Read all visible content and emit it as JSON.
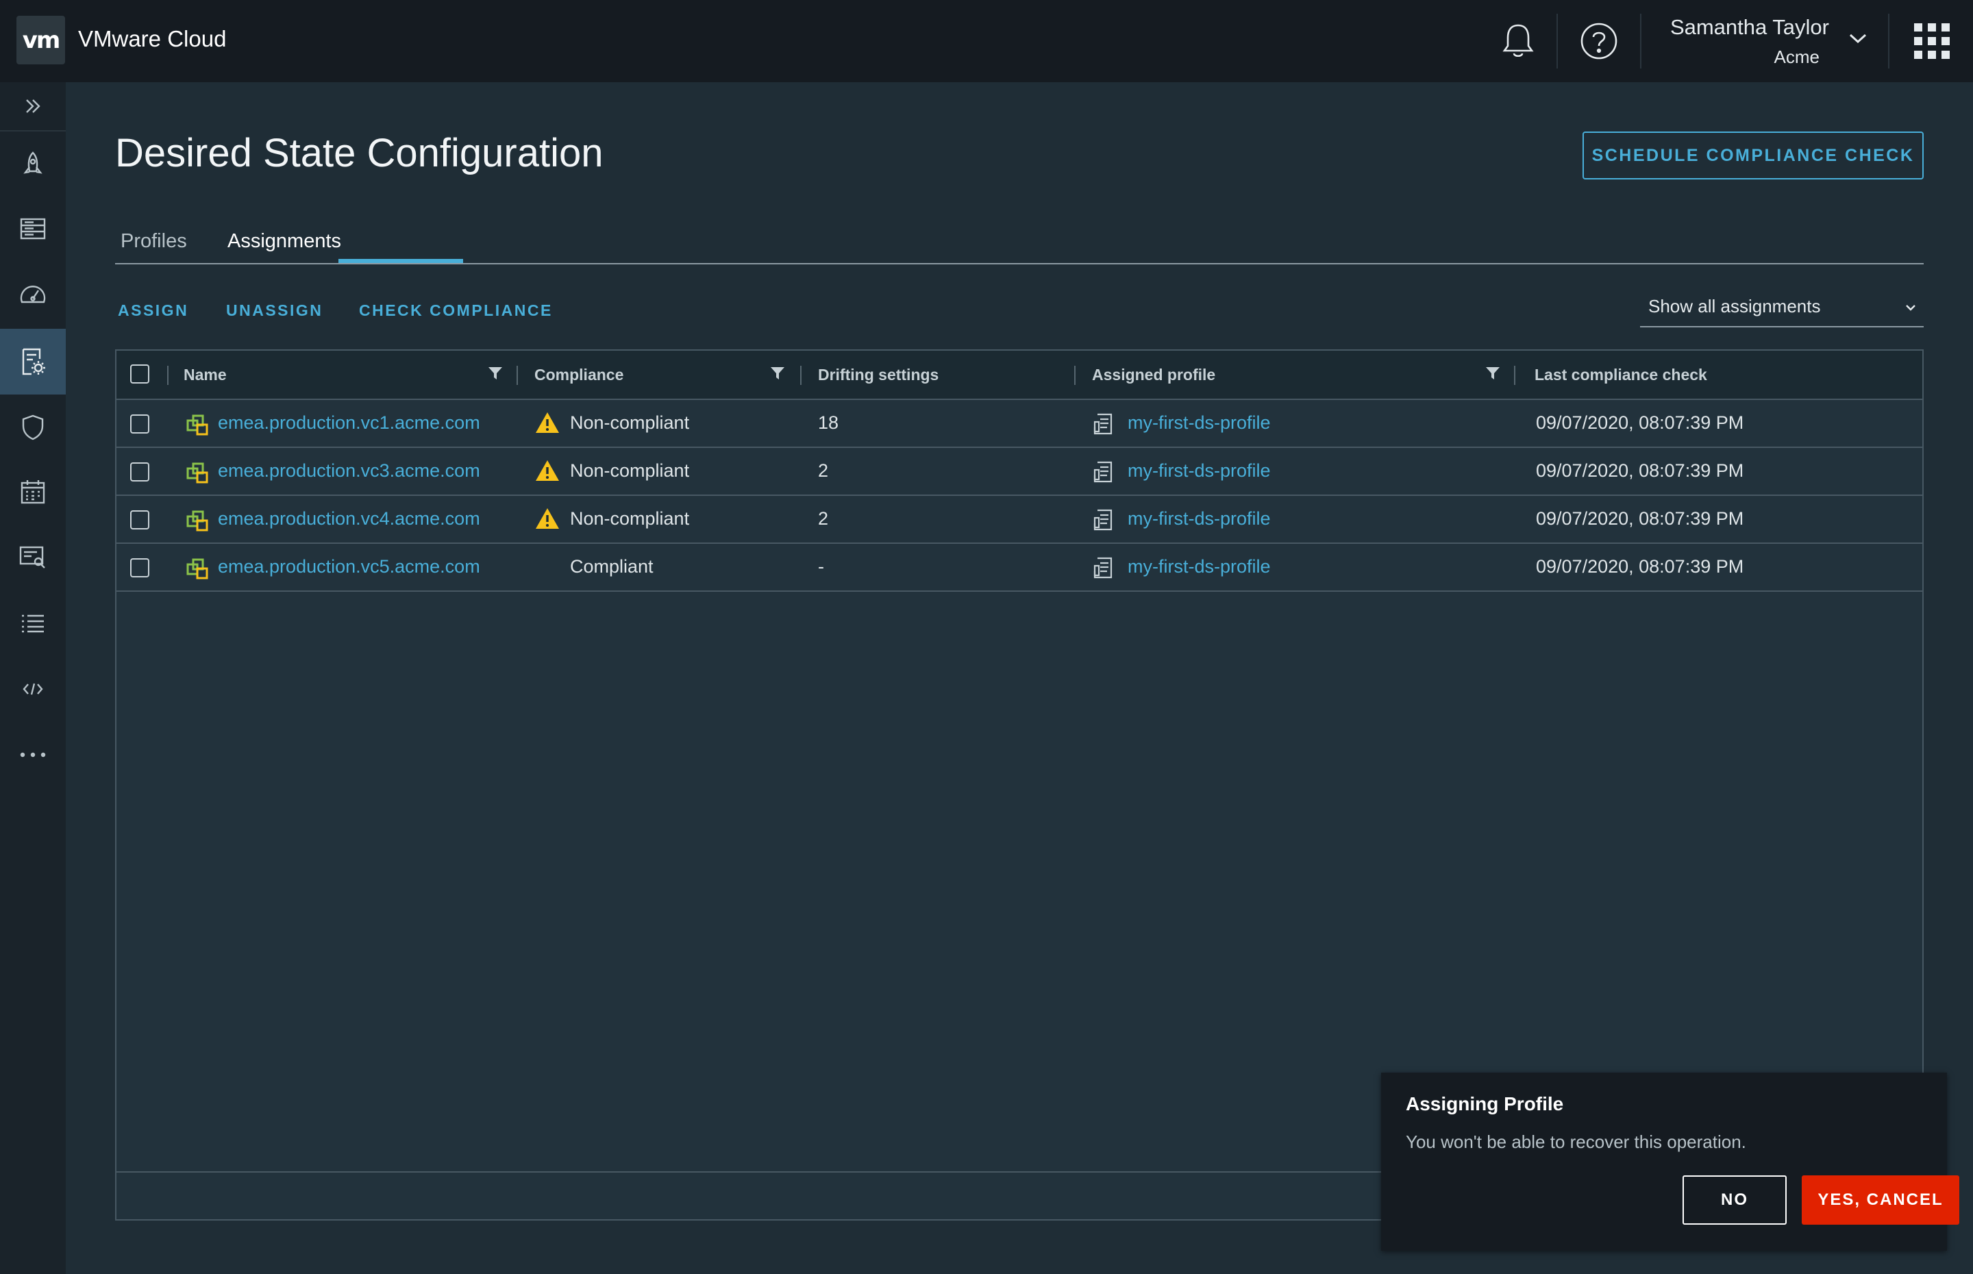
{
  "header": {
    "logo_text": "vm",
    "app_title": "VMware Cloud",
    "user_name": "Samantha Taylor",
    "user_org": "Acme",
    "icons": [
      "bell-icon",
      "help-icon",
      "chevron-down-icon",
      "app-grid-icon"
    ]
  },
  "sidenav": {
    "items": [
      "expand-icon",
      "rocket-icon",
      "inventory-icon",
      "dashboard-icon",
      "config-profile-icon",
      "shield-icon",
      "calendar-icon",
      "report-search-icon",
      "list-icon",
      "code-icon",
      "more-icon"
    ],
    "active": "config-profile-icon"
  },
  "page": {
    "title": "Desired State Configuration",
    "schedule_button": "SCHEDULE COMPLIANCE CHECK"
  },
  "tabs": [
    {
      "label": "Profiles",
      "active": false
    },
    {
      "label": "Assignments",
      "active": true
    }
  ],
  "actions": {
    "assign": "ASSIGN",
    "unassign": "UNASSIGN",
    "check": "CHECK COMPLIANCE"
  },
  "filter_select": {
    "value": "Show all assignments"
  },
  "table": {
    "columns": [
      "Name",
      "Compliance",
      "Drifting settings",
      "Assigned profile",
      "Last compliance check"
    ],
    "rows": [
      {
        "name": "emea.production.vc1.acme.com",
        "compliance": "Non-compliant",
        "warning": true,
        "drifting": "18",
        "profile": "my-first-ds-profile",
        "last_check": "09/07/2020, 08:07:39 PM"
      },
      {
        "name": "emea.production.vc3.acme.com",
        "compliance": "Non-compliant",
        "warning": true,
        "drifting": "2",
        "profile": "my-first-ds-profile",
        "last_check": "09/07/2020, 08:07:39 PM"
      },
      {
        "name": "emea.production.vc4.acme.com",
        "compliance": "Non-compliant",
        "warning": true,
        "drifting": "2",
        "profile": "my-first-ds-profile",
        "last_check": "09/07/2020, 08:07:39 PM"
      },
      {
        "name": "emea.production.vc5.acme.com",
        "compliance": "Compliant",
        "warning": false,
        "drifting": "-",
        "profile": "my-first-ds-profile",
        "last_check": "09/07/2020, 08:07:39 PM"
      }
    ]
  },
  "toast": {
    "title": "Assigning Profile",
    "message": "You won't be able to recover this operation.",
    "no_label": "NO",
    "yes_label": "YES, CANCEL"
  },
  "colors": {
    "accent": "#49afd9",
    "warning": "#f7c21b",
    "danger": "#e12200",
    "vcenter_green": "#8bc34a"
  }
}
